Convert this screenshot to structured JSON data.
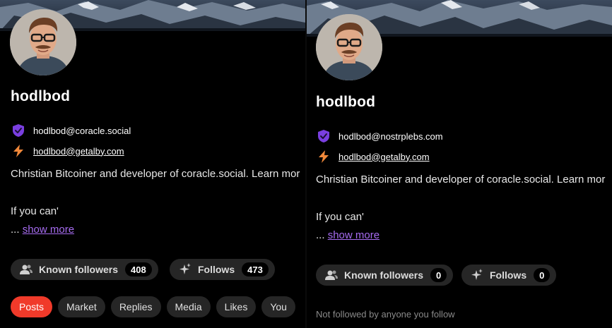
{
  "left_profile": {
    "name": "hodlbod",
    "nip05": "hodlbod@coracle.social",
    "lud16": "hodlbod@getalby.com",
    "about_line1": "Christian Bitcoiner and developer of coracle.social. Learn mor",
    "about_line2": "If you can'",
    "ellipsis": "...",
    "show_more": "show more",
    "known_followers_label": "Known followers",
    "known_followers_count": "408",
    "follows_label": "Follows",
    "follows_count": "473",
    "tabs": [
      "Posts",
      "Market",
      "Replies",
      "Media",
      "Likes",
      "You"
    ]
  },
  "right_profile": {
    "name": "hodlbod",
    "nip05": "hodlbod@nostrplebs.com",
    "lud16": "hodlbod@getalby.com",
    "about_line1": "Christian Bitcoiner and developer of coracle.social. Learn mor",
    "about_line2": "If you can'",
    "ellipsis": "...",
    "show_more": "show more",
    "known_followers_label": "Known followers",
    "known_followers_count": "0",
    "follows_label": "Follows",
    "follows_count": "0",
    "empty_message": "Not followed by anyone you follow"
  },
  "colors": {
    "accent_purple": "#7a3fe0",
    "link_purple": "#a66cf0",
    "lightning_orange": "#f0883a",
    "active_tab_red": "#f03a2a",
    "pill_bg": "#262626"
  },
  "icons": {
    "nip05": "shield-check-icon",
    "lud16": "lightning-icon",
    "known_followers": "users-icon",
    "follows": "sparkles-icon"
  }
}
